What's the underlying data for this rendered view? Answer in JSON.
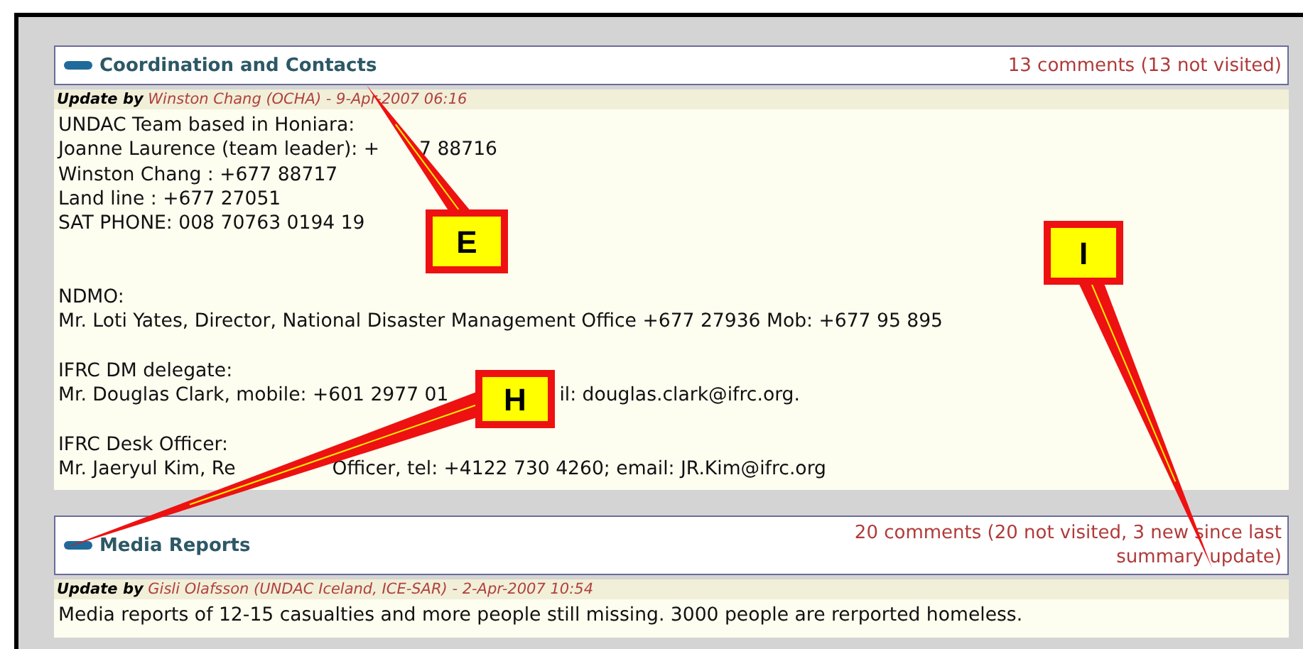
{
  "sections": [
    {
      "title": "Coordination and Contacts",
      "expanded": true,
      "comments": "13 comments (13 not visited)",
      "update_label": "Update by",
      "author": "Winston Chang (OCHA) - 9-Apr-2007 06:16",
      "paragraphs": [
        [
          "UNDAC Team based in Honiara:",
          [
            "Joanne Laurence (team leader): +",
            "7 88716"
          ],
          "Winston Chang : +677 88717",
          "Land line : +677 27051",
          "SAT PHONE: 008 70763 0194 19"
        ],
        [
          "NDMO:",
          "Mr. Loti Yates, Director, National Disaster Management Office +677 27936 Mob: +677 95 895"
        ],
        [
          "IFRC DM delegate:",
          [
            "Mr. Douglas Clark, mobile: +601 2977 01",
            "il: douglas.clark@ifrc.org."
          ]
        ],
        [
          "IFRC Desk Officer:",
          [
            "Mr. Jaeryul Kim, Re",
            "Officer, tel: +4122 730 4260; email: JR.Kim@ifrc.org"
          ]
        ]
      ]
    },
    {
      "title": "Media Reports",
      "expanded": true,
      "comments": "20 comments (20 not visited, 3 new since last summary update)",
      "update_label": "Update by",
      "author": "Gisli Olafsson (UNDAC Iceland, ICE-SAR) - 2-Apr-2007 10:54",
      "paragraphs": [
        [
          "Media reports of 12-15 casualties and more people still missing. 3000 people are rerported homeless."
        ]
      ]
    }
  ],
  "callouts": [
    {
      "letter": "E"
    },
    {
      "letter": "I"
    },
    {
      "letter": "H"
    }
  ]
}
